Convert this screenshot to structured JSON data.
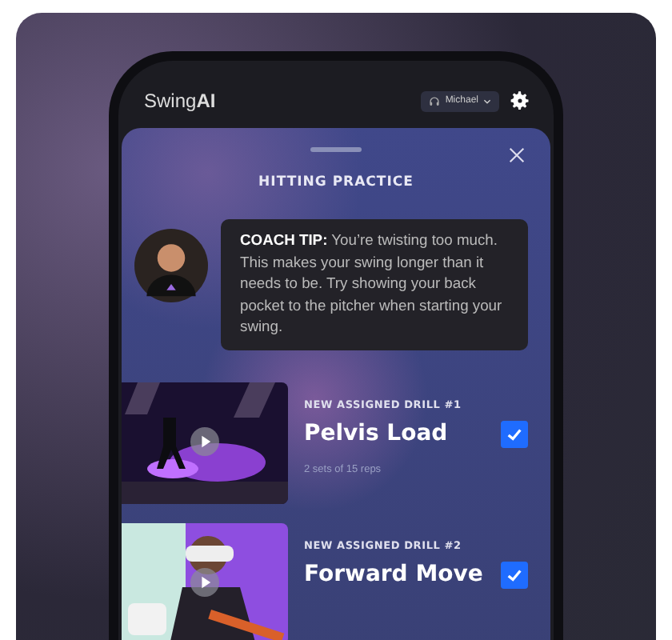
{
  "app": {
    "logo": "Swing**AI**",
    "user": "Michael"
  },
  "panel": {
    "title": "HITTING PRACTICE",
    "tip": "**COACH TIP:** You’re twisting too much. This makes your swing longer than it needs to be. Try showing your back pocket to the pitcher when starting your swing."
  },
  "drills": [
    {
      "eyebrow": "NEW ASSIGNED DRILL #1",
      "title": "Pelvis Load",
      "detail": "2 sets of 15 reps",
      "checked": true
    },
    {
      "eyebrow": "NEW ASSIGNED DRILL #2",
      "title": "Forward Move",
      "checked": true
    }
  ]
}
